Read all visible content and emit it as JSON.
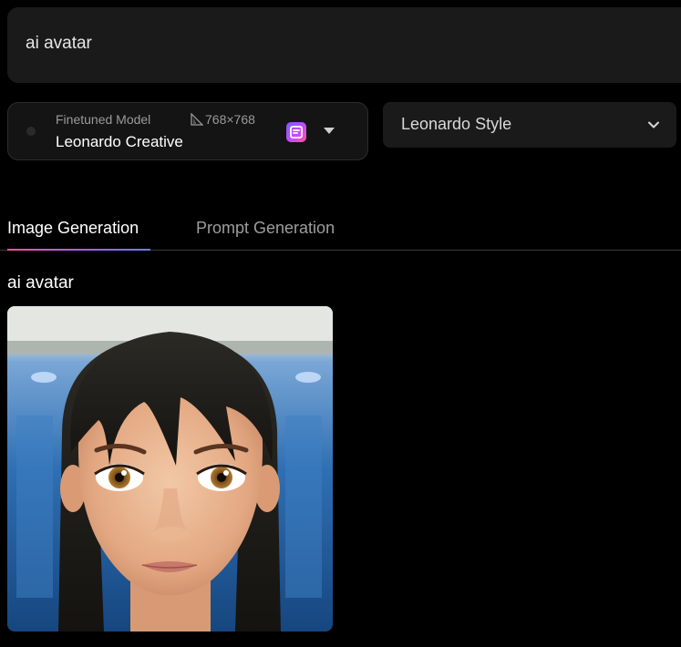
{
  "prompt": {
    "value": "ai avatar"
  },
  "model": {
    "kind": "Finetuned Model",
    "dimensions": "768×768",
    "name": "Leonardo Creative",
    "icons": [
      "model-thumbnail-icon",
      "ruler-icon",
      "finetune-badge-icon",
      "caret-down-icon"
    ]
  },
  "style_select": {
    "selected": "Leonardo Style",
    "icon": "chevron-down-icon"
  },
  "tabs": [
    {
      "label": "Image Generation",
      "active": true
    },
    {
      "label": "Prompt Generation",
      "active": false
    }
  ],
  "results": {
    "title": "ai avatar",
    "image_subject": "ai-generated-avatar-image"
  },
  "colors": {
    "background": "#000000",
    "panel": "#1a1a1a",
    "active_tab_underline_start": "#ff4f9a",
    "active_tab_underline_end": "#6f7bff",
    "badge_gradient_start": "#7a5cff",
    "badge_gradient_end": "#ff4fa3"
  }
}
